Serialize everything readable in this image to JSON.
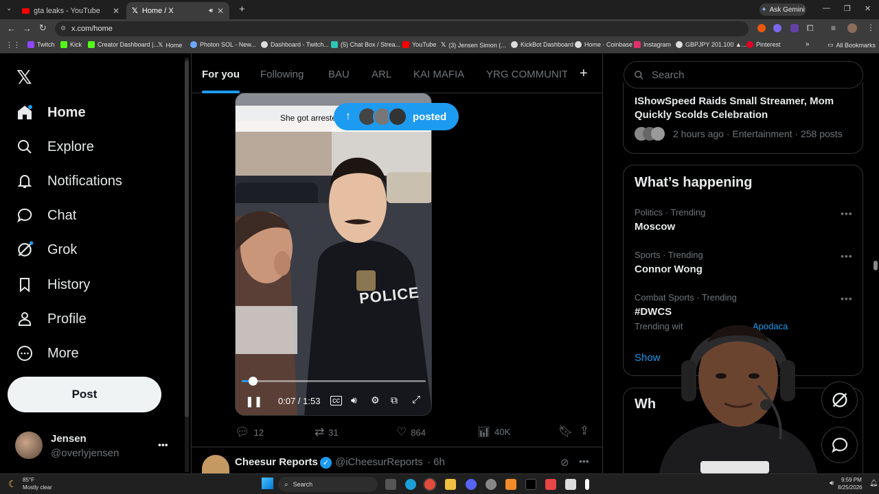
{
  "browser": {
    "tabs": [
      {
        "label": "gta leaks - YouTube"
      },
      {
        "label": "Home / X"
      }
    ],
    "ask_gemini": "Ask Gemini",
    "url": "x.com/home",
    "bookmarks": [
      {
        "label": "Twitch",
        "color": "#9146ff"
      },
      {
        "label": "Kick",
        "color": "#53fc18"
      },
      {
        "label": "Creator Dashboard |...",
        "color": "#53fc18"
      },
      {
        "label": "Home",
        "color": "#ffffff"
      },
      {
        "label": "Photon SOL - New...",
        "color": "#6aa9ff"
      },
      {
        "label": "Dashboard - Twitch...",
        "color": "#dddddd"
      },
      {
        "label": "(5) Chat Box / Strea...",
        "color": "#2ec4b6"
      },
      {
        "label": "YouTube",
        "color": "#ff0000"
      },
      {
        "label": "(3) Jensen Simon (...",
        "color": "#ffffff"
      },
      {
        "label": "KickBot Dashboard",
        "color": "#dddddd"
      },
      {
        "label": "Home · Coinbase",
        "color": "#dddddd"
      },
      {
        "label": "Instagram",
        "color": "#e1306c"
      },
      {
        "label": "GBPJPY 201.100 ▲...",
        "color": "#dddddd"
      },
      {
        "label": "Pinterest",
        "color": "#e60023"
      }
    ],
    "all_bookmarks": "All Bookmarks"
  },
  "sidebar": {
    "items": [
      {
        "label": "Home",
        "icon": "home-icon"
      },
      {
        "label": "Explore",
        "icon": "search-icon"
      },
      {
        "label": "Notifications",
        "icon": "bell-icon"
      },
      {
        "label": "Chat",
        "icon": "chat-icon"
      },
      {
        "label": "Grok",
        "icon": "grok-icon"
      },
      {
        "label": "History",
        "icon": "bookmark-icon"
      },
      {
        "label": "Profile",
        "icon": "person-icon"
      },
      {
        "label": "More",
        "icon": "more-icon"
      }
    ],
    "post_label": "Post",
    "user": {
      "name": "Jensen",
      "handle": "@overlyjensen"
    }
  },
  "feed": {
    "tabs": [
      "For you",
      "Following",
      "BAU",
      "ARL",
      "KAI MAFIA",
      "YRG COMMUNIT"
    ],
    "active_tab": "For you",
    "video": {
      "caption": "She got arreste",
      "posted_label": "posted",
      "time": "0:07 / 1:53",
      "progress": 0.06,
      "police_text": "POLICE"
    },
    "actions": {
      "replies": "12",
      "reposts": "31",
      "likes": "864",
      "views": "40K"
    },
    "next_post": {
      "author": "Cheesur Reports",
      "handle": "@iCheesurReports",
      "time": "· 6h"
    }
  },
  "right": {
    "search_placeholder": "Search",
    "top_story": {
      "title": "IShowSpeed Raids Small Streamer, Mom Quickly Scolds Celebration",
      "meta": "2 hours ago · Entertainment · 258 posts"
    },
    "whats_happening": "What’s happening",
    "trends": [
      {
        "meta": "Politics · Trending",
        "name": "Moscow"
      },
      {
        "meta": "Sports · Trending",
        "name": "Connor Wong"
      },
      {
        "meta": "Combat Sports · Trending",
        "name": "#DWCS",
        "extra": "Trending wit",
        "extra_link": "Apodaca"
      }
    ],
    "show_more": "Show",
    "next_heading": "Wh"
  },
  "taskbar": {
    "weather_temp": "85°F",
    "weather_desc": "Mostly clear",
    "search": "Search",
    "time": "9:59 PM",
    "date": "8/25/2026"
  }
}
